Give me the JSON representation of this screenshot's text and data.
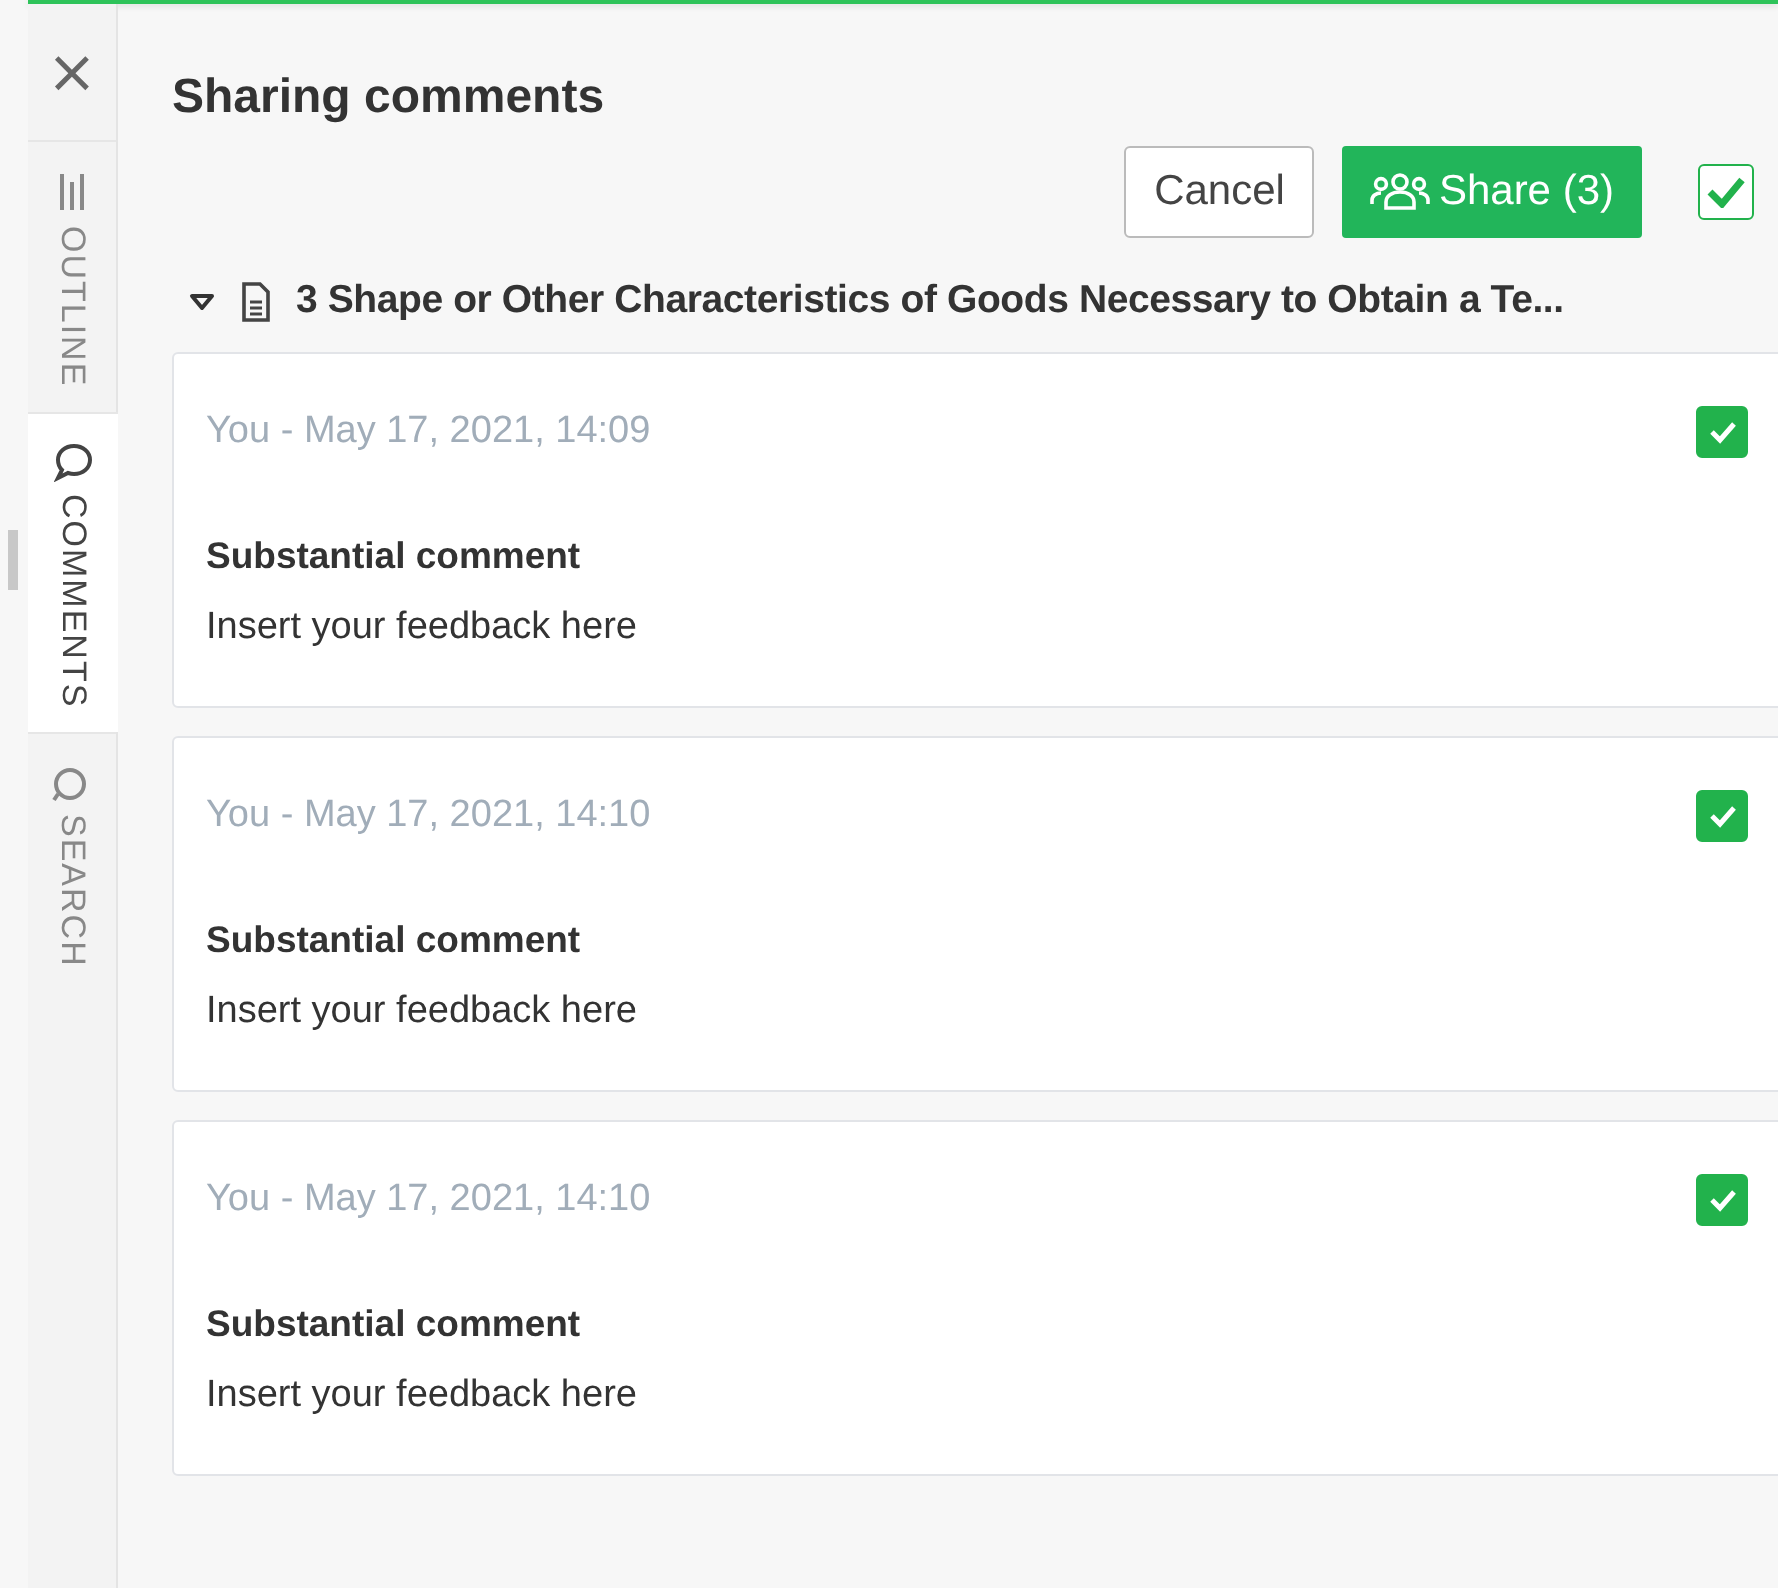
{
  "close_label": "×",
  "rail_tabs": [
    {
      "kind": "outline",
      "label": "OUTLINE",
      "selected": false
    },
    {
      "kind": "comments",
      "label": "COMMENTS",
      "selected": true
    },
    {
      "kind": "search",
      "label": "SEARCH",
      "selected": false
    }
  ],
  "title": "Sharing comments",
  "cancel_button": "Cancel",
  "share_button": "Share (3)",
  "select_all": {
    "checked": true
  },
  "section": {
    "expanded": true,
    "title": "3 Shape or Other Characteristics of Goods Necessary to Obtain a Te..."
  },
  "comments": [
    {
      "meta": "You - May 17, 2021, 14:09",
      "type": "Substantial comment",
      "text": "Insert your feedback here",
      "checked": true
    },
    {
      "meta": "You - May 17, 2021, 14:10",
      "type": "Substantial comment",
      "text": "Insert your feedback here",
      "checked": true
    },
    {
      "meta": "You - May 17, 2021, 14:10",
      "type": "Substantial comment",
      "text": "Insert your feedback here",
      "checked": true
    }
  ]
}
